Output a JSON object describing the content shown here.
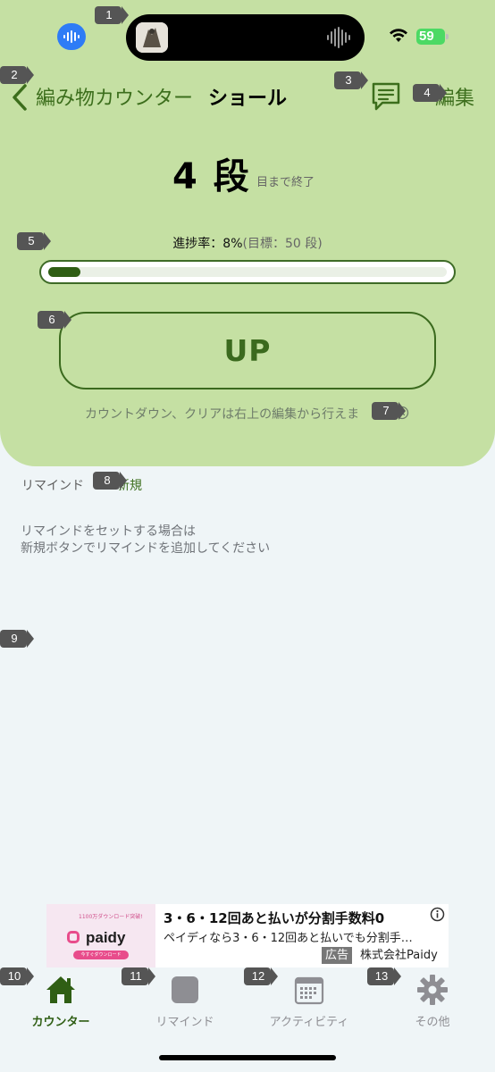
{
  "nav": {
    "back_label": "編み物カウンター",
    "title": "ショール",
    "edit_label": "編集"
  },
  "status_bar": {
    "battery_level": "59",
    "battery_color": "#4cd964"
  },
  "counter": {
    "value": "4 段",
    "suffix": "目まで終了",
    "progress_text": "進捗率：8%",
    "goal_text": "(目標：50 段)",
    "progress_percent": 8,
    "up_label": "UP",
    "hint": "カウントダウン、クリアは右上の編集から行えま"
  },
  "remind": {
    "label": "リマインド",
    "new_label": "新規",
    "empty_line1": "リマインドをセットする場合は",
    "empty_line2": "新規ボタンでリマインドを追加してください"
  },
  "ad": {
    "image_tiny_text": "1100万ダウンロード突破!",
    "image_logo": "paidy",
    "image_pill": "今すぐダウンロード",
    "title": "3・6・12回あと払いが分割手数料0",
    "description": "ペイディなら3・6・12回あと払いでも分割手…",
    "badge": "広告",
    "advertiser": "株式会社Paidy"
  },
  "tabs": [
    {
      "label": "カウンター",
      "icon": "home-icon",
      "active": true
    },
    {
      "label": "リマインド",
      "icon": "square-icon",
      "active": false
    },
    {
      "label": "アクティビティ",
      "icon": "calendar-icon",
      "active": false
    },
    {
      "label": "その他",
      "icon": "gear-icon",
      "active": false
    }
  ],
  "markers": [
    "1",
    "2",
    "3",
    "4",
    "5",
    "6",
    "7",
    "8",
    "9",
    "10",
    "11",
    "12",
    "13"
  ],
  "colors": {
    "panel": "#c5e0a3",
    "accent": "#3c6e1c",
    "background": "#eff5f7"
  }
}
